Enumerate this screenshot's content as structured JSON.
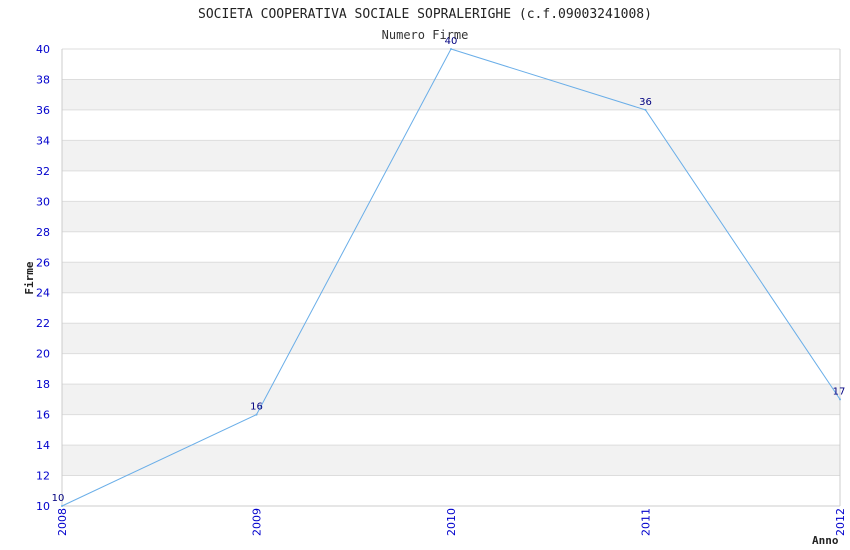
{
  "chart_data": {
    "type": "line",
    "title": "SOCIETA COOPERATIVA SOCIALE SOPRALERIGHE (c.f.09003241008)",
    "subtitle": "Numero Firme",
    "xlabel": "Anno",
    "ylabel": "Firme",
    "categories": [
      "2008",
      "2009",
      "2010",
      "2011",
      "2012"
    ],
    "values": [
      10,
      16,
      40,
      36,
      17
    ],
    "ylim": [
      10,
      40
    ],
    "ytick_step": 2,
    "grid": true,
    "legend": "none",
    "colors": {
      "line": "#6aaee8",
      "tick_text": "#0000cc",
      "label_text": "#000080",
      "band": "#f2f2f2",
      "grid": "#dddddd",
      "axis": "#cccccc"
    }
  }
}
